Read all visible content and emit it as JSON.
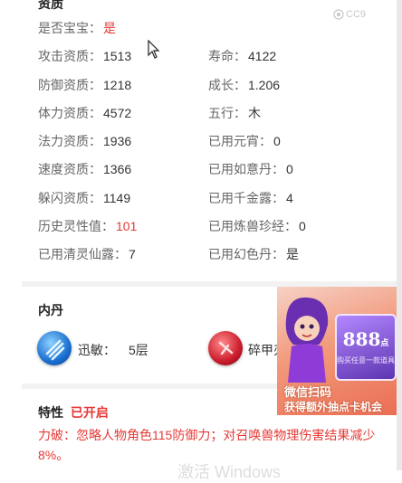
{
  "header_partial": "资质",
  "watermark": "CC9",
  "stats": {
    "left": [
      {
        "label": "是否宝宝：",
        "value": "是",
        "red": true
      },
      {
        "label": "攻击资质：",
        "value": "1513"
      },
      {
        "label": "防御资质：",
        "value": "1218"
      },
      {
        "label": "体力资质：",
        "value": "4572"
      },
      {
        "label": "法力资质：",
        "value": "1936"
      },
      {
        "label": "速度资质：",
        "value": "1366"
      },
      {
        "label": "躲闪资质：",
        "value": "1149"
      },
      {
        "label": "历史灵性值：",
        "value": "101",
        "red": true
      },
      {
        "label": "已用清灵仙露：",
        "value": "7"
      }
    ],
    "right": [
      {
        "label": "",
        "value": ""
      },
      {
        "label": "寿命：",
        "value": "4122"
      },
      {
        "label": "成长：",
        "value": "1.206"
      },
      {
        "label": "五行：",
        "value": "木"
      },
      {
        "label": "已用元宵：",
        "value": "0"
      },
      {
        "label": "已用如意丹：",
        "value": "0"
      },
      {
        "label": "已用千金露：",
        "value": "4"
      },
      {
        "label": "已用炼兽珍经：",
        "value": "0"
      },
      {
        "label": "已用幻色丹：",
        "value": "是"
      }
    ]
  },
  "neidan": {
    "title": "内丹",
    "skills": [
      {
        "name": "迅敏：",
        "level": "5层",
        "icon": "swift-icon",
        "color": "#1a6fd1"
      },
      {
        "name": "碎甲刃",
        "level": "",
        "icon": "armor-break-icon",
        "color": "#cc1c2c"
      }
    ]
  },
  "trait": {
    "title": "特性",
    "status": "已开启",
    "description": "力破：忽略人物角色115防御力；对召唤兽物理伤害结果减少8%。"
  },
  "ad": {
    "card_value": "888",
    "card_unit": "点",
    "card_sub": "购买任意一款道具",
    "line1": "微信扫码",
    "line2": "获得额外抽点卡机会"
  },
  "windows_watermark": "激活 Windows"
}
